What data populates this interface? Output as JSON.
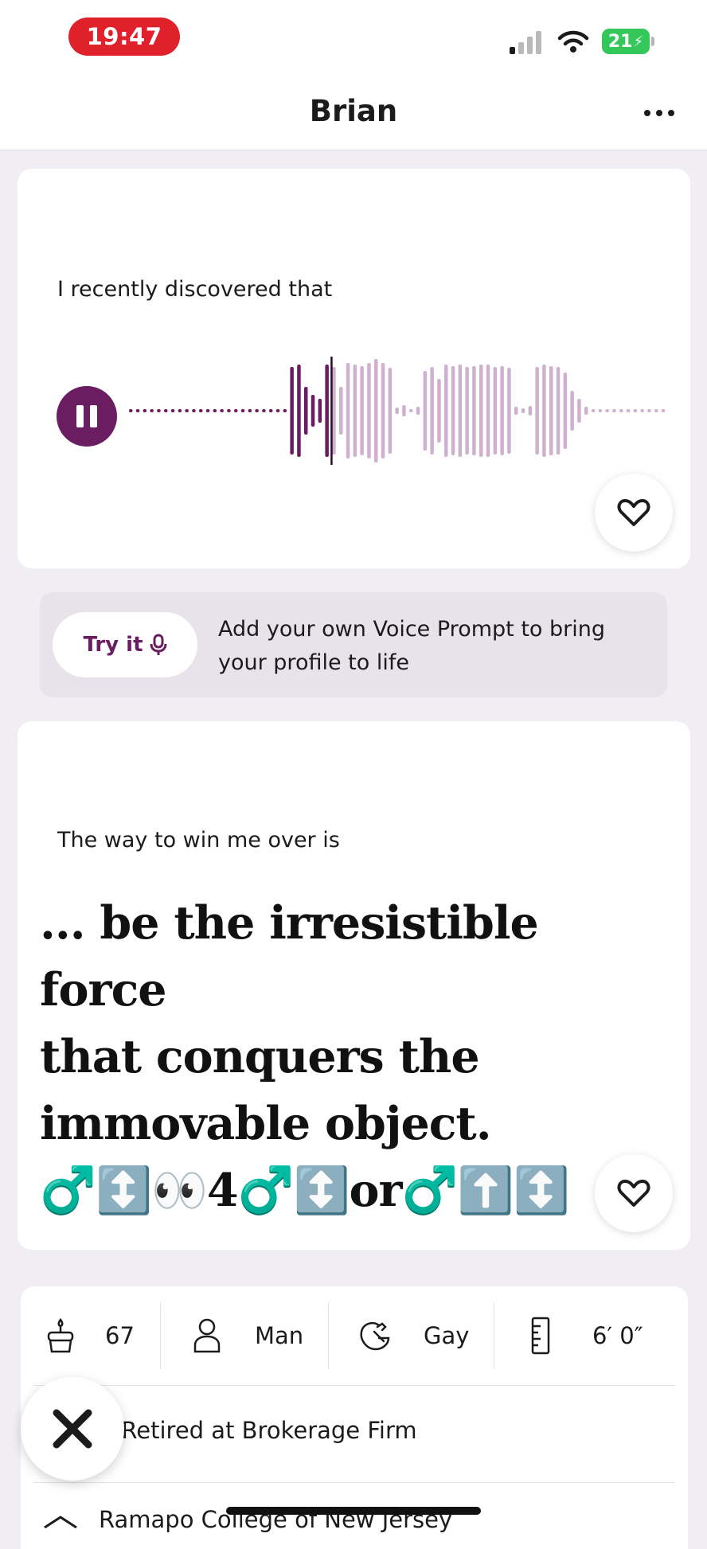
{
  "status_bar": {
    "time": "19:47",
    "battery": "21"
  },
  "header": {
    "title": "Brian"
  },
  "voice_prompt": {
    "label": "I recently discovered that",
    "playback_state": "playing",
    "progress": 0.37
  },
  "voice_banner": {
    "button_label": "Try it",
    "text": "Add your own Voice Prompt to bring your profile to life"
  },
  "text_prompt": {
    "label": "The way to win me over is",
    "answer_lines": [
      "... be the irresistible force",
      "that conquers the",
      "immovable object.",
      "♂️↕️👀4♂️↕️or♂️⬆️↕️"
    ]
  },
  "info": {
    "age": "67",
    "gender": "Man",
    "orientation": "Gay",
    "height": "6′ 0″",
    "job": ", Retired  at Brokerage Firm",
    "school": "Ramapo College of New Jersey"
  },
  "colors": {
    "accent": "#6b1d61",
    "waveform_played": "#6b1d61",
    "waveform_unplayed": "#cfb1cf",
    "banner_bg": "#e8e3ea"
  },
  "icons": {
    "more": "more-dots-icon",
    "pause": "pause-icon",
    "heart": "heart-outline-icon",
    "mic": "microphone-icon",
    "cake": "birthday-cake-icon",
    "person": "person-icon",
    "orientation": "orientation-icon",
    "ruler": "ruler-icon",
    "close": "close-x-icon",
    "school": "graduation-cap-icon"
  }
}
